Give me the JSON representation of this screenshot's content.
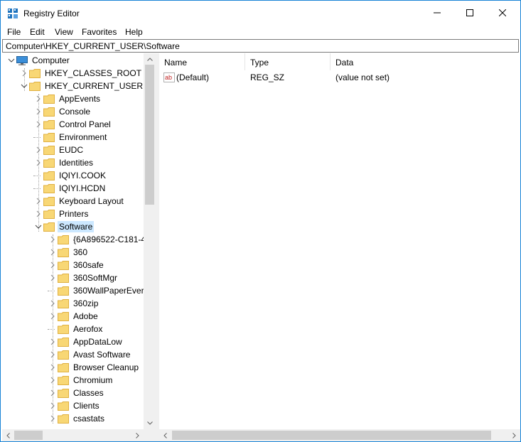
{
  "window": {
    "title": "Registry Editor"
  },
  "menu": [
    "File",
    "Edit",
    "View",
    "Favorites",
    "Help"
  ],
  "address": "Computer\\HKEY_CURRENT_USER\\Software",
  "tree": [
    {
      "label": "Computer",
      "level": 0,
      "icon": "computer-icon",
      "expander": "expanded"
    },
    {
      "label": "HKEY_CLASSES_ROOT",
      "level": 1,
      "icon": "folder-icon",
      "expander": "collapsed"
    },
    {
      "label": "HKEY_CURRENT_USER",
      "level": 1,
      "icon": "folder-icon",
      "expander": "expanded"
    },
    {
      "label": "AppEvents",
      "level": 2,
      "icon": "folder-icon",
      "expander": "collapsed"
    },
    {
      "label": "Console",
      "level": 2,
      "icon": "folder-icon",
      "expander": "collapsed"
    },
    {
      "label": "Control Panel",
      "level": 2,
      "icon": "folder-icon",
      "expander": "collapsed"
    },
    {
      "label": "Environment",
      "level": 2,
      "icon": "folder-icon",
      "expander": "none"
    },
    {
      "label": "EUDC",
      "level": 2,
      "icon": "folder-icon",
      "expander": "collapsed"
    },
    {
      "label": "Identities",
      "level": 2,
      "icon": "folder-icon",
      "expander": "collapsed"
    },
    {
      "label": "IQIYI.COOK",
      "level": 2,
      "icon": "folder-icon",
      "expander": "none"
    },
    {
      "label": "IQIYI.HCDN",
      "level": 2,
      "icon": "folder-icon",
      "expander": "none"
    },
    {
      "label": "Keyboard Layout",
      "level": 2,
      "icon": "folder-icon",
      "expander": "collapsed"
    },
    {
      "label": "Printers",
      "level": 2,
      "icon": "folder-icon",
      "expander": "collapsed"
    },
    {
      "label": "Software",
      "level": 2,
      "icon": "folder-icon",
      "expander": "expanded",
      "selected": true
    },
    {
      "label": "{6A896522-C181-4",
      "level": 3,
      "icon": "folder-icon",
      "expander": "collapsed"
    },
    {
      "label": "360",
      "level": 3,
      "icon": "folder-icon",
      "expander": "collapsed"
    },
    {
      "label": "360safe",
      "level": 3,
      "icon": "folder-icon",
      "expander": "collapsed"
    },
    {
      "label": "360SoftMgr",
      "level": 3,
      "icon": "folder-icon",
      "expander": "collapsed"
    },
    {
      "label": "360WallPaperEver",
      "level": 3,
      "icon": "folder-icon",
      "expander": "none"
    },
    {
      "label": "360zip",
      "level": 3,
      "icon": "folder-icon",
      "expander": "collapsed"
    },
    {
      "label": "Adobe",
      "level": 3,
      "icon": "folder-icon",
      "expander": "collapsed"
    },
    {
      "label": "Aerofox",
      "level": 3,
      "icon": "folder-icon",
      "expander": "none"
    },
    {
      "label": "AppDataLow",
      "level": 3,
      "icon": "folder-icon",
      "expander": "collapsed"
    },
    {
      "label": "Avast Software",
      "level": 3,
      "icon": "folder-icon",
      "expander": "collapsed"
    },
    {
      "label": "Browser Cleanup",
      "level": 3,
      "icon": "folder-icon",
      "expander": "collapsed"
    },
    {
      "label": "Chromium",
      "level": 3,
      "icon": "folder-icon",
      "expander": "collapsed"
    },
    {
      "label": "Classes",
      "level": 3,
      "icon": "folder-icon",
      "expander": "collapsed"
    },
    {
      "label": "Clients",
      "level": 3,
      "icon": "folder-icon",
      "expander": "collapsed"
    },
    {
      "label": "csastats",
      "level": 3,
      "icon": "folder-icon",
      "expander": "collapsed"
    }
  ],
  "list": {
    "columns": [
      "Name",
      "Type",
      "Data"
    ],
    "rows": [
      {
        "name": "(Default)",
        "type": "REG_SZ",
        "data": "(value not set)",
        "icon": "string-value-icon"
      }
    ]
  },
  "colors": {
    "accent": "#1883d7",
    "selection": "#cce8ff",
    "folder": "#f8d775",
    "folder_dark": "#e0b040"
  }
}
